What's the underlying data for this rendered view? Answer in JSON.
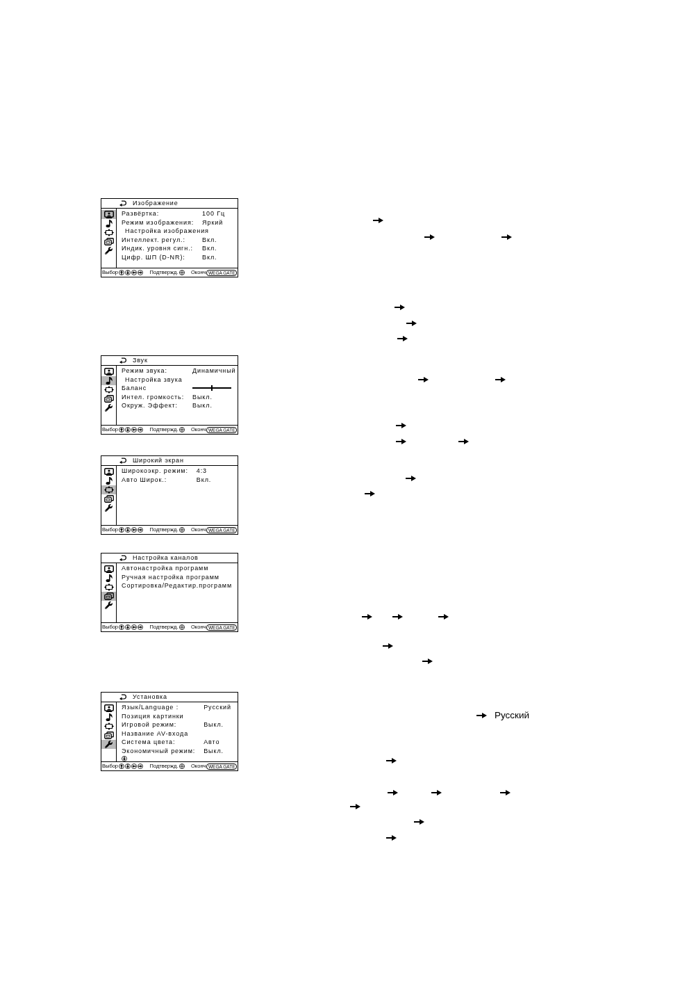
{
  "menus": [
    {
      "title": "Изображение",
      "categories": [
        {
          "kind": "picture",
          "selected": true
        },
        {
          "kind": "sound",
          "selected": false
        },
        {
          "kind": "wide",
          "selected": false
        },
        {
          "kind": "channels",
          "selected": false
        },
        {
          "kind": "setup",
          "selected": false
        }
      ],
      "items": [
        {
          "kind": "option",
          "label": "Развёртка:",
          "value": "100 Гц"
        },
        {
          "kind": "option",
          "label": "Режим изображения:",
          "value": "Яркий"
        },
        {
          "kind": "submenu",
          "label": "Настройка изображения"
        },
        {
          "kind": "option",
          "label": "Интеллект. регул.:",
          "value": "Вкл."
        },
        {
          "kind": "option",
          "label": "Индик. уровня сигн.:",
          "value": "Вкл."
        },
        {
          "kind": "option",
          "label": "Цифр. ШП (D-NR):",
          "value": "Вкл."
        }
      ],
      "more_below": false,
      "footer": {
        "select_label": "Выбор",
        "confirm_label": "Подтвержд.",
        "exit_label": "Оконч",
        "exit_key": "WEGA GATE"
      }
    },
    {
      "title": "Звук",
      "categories": [
        {
          "kind": "picture",
          "selected": false
        },
        {
          "kind": "sound",
          "selected": true
        },
        {
          "kind": "wide",
          "selected": false
        },
        {
          "kind": "channels",
          "selected": false
        },
        {
          "kind": "setup",
          "selected": false
        }
      ],
      "items": [
        {
          "kind": "option",
          "label": "Режим звука:",
          "value": "Динамичный"
        },
        {
          "kind": "submenu",
          "label": "Настройка звука"
        },
        {
          "kind": "slider",
          "label": "Баланс",
          "level": 0.5
        },
        {
          "kind": "option",
          "label": "Интел. громкость:",
          "value": "Выкл."
        },
        {
          "kind": "option",
          "label": "Окруж. Эффект:",
          "value": "Выкл."
        }
      ],
      "more_below": false,
      "footer": {
        "select_label": "Выбор",
        "confirm_label": "Подтвержд.",
        "exit_label": "Оконч",
        "exit_key": "WEGA GATE"
      }
    },
    {
      "title": "Широкий экран",
      "categories": [
        {
          "kind": "picture",
          "selected": false
        },
        {
          "kind": "sound",
          "selected": false
        },
        {
          "kind": "wide",
          "selected": true
        },
        {
          "kind": "channels",
          "selected": false
        },
        {
          "kind": "setup",
          "selected": false
        }
      ],
      "items": [
        {
          "kind": "option",
          "label": "Широкоэкр. режим:",
          "value": "4:3"
        },
        {
          "kind": "option",
          "label": "Авто Широк.:",
          "value": "Вкл."
        }
      ],
      "more_below": false,
      "footer": {
        "select_label": "Выбор",
        "confirm_label": "Подтвержд.",
        "exit_label": "Оконч",
        "exit_key": "WEGA GATE"
      }
    },
    {
      "title": "Настройка каналов",
      "categories": [
        {
          "kind": "picture",
          "selected": false
        },
        {
          "kind": "sound",
          "selected": false
        },
        {
          "kind": "wide",
          "selected": false
        },
        {
          "kind": "channels",
          "selected": true
        },
        {
          "kind": "setup",
          "selected": false
        }
      ],
      "items": [
        {
          "kind": "command",
          "label": "Автонастройка программ"
        },
        {
          "kind": "command",
          "label": "Ручная настройка программ"
        },
        {
          "kind": "command",
          "label": "Сортировка/Редактир.программ"
        }
      ],
      "more_below": false,
      "footer": {
        "select_label": "Выбор",
        "confirm_label": "Подтвержд.",
        "exit_label": "Оконч",
        "exit_key": "WEGA GATE"
      }
    },
    {
      "title": "Установка",
      "categories": [
        {
          "kind": "picture",
          "selected": false
        },
        {
          "kind": "sound",
          "selected": false
        },
        {
          "kind": "wide",
          "selected": false
        },
        {
          "kind": "channels",
          "selected": false
        },
        {
          "kind": "setup",
          "selected": true
        }
      ],
      "items": [
        {
          "kind": "option",
          "label": "Язык/Language :",
          "value": "Русский"
        },
        {
          "kind": "command",
          "label": "Позиция картинки"
        },
        {
          "kind": "option",
          "label": "Игровой режим:",
          "value": "Выкл."
        },
        {
          "kind": "command",
          "label": "Название AV-входа"
        },
        {
          "kind": "option",
          "label": "Система цвета:",
          "value": "Авто"
        },
        {
          "kind": "option",
          "label": "Экономичный режим:",
          "value": "Выкл."
        }
      ],
      "more_below": true,
      "footer": {
        "select_label": "Выбор",
        "confirm_label": "Подтвержд.",
        "exit_label": "Оконч",
        "exit_key": "WEGA GATE"
      }
    }
  ],
  "notes": [
    {
      "text": "Русский"
    }
  ]
}
